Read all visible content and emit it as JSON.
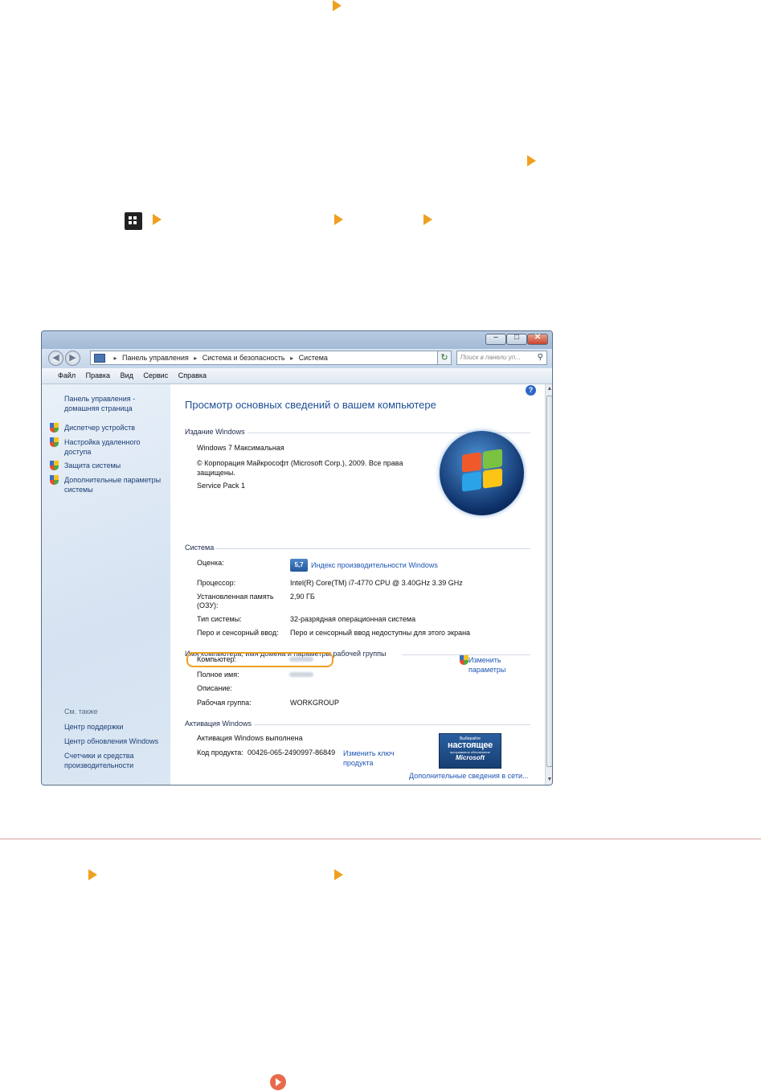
{
  "window": {
    "buttons": {
      "minimize": "–",
      "maximize": "□",
      "close": "✕"
    },
    "address": {
      "part1": "Панель управления",
      "part2": "Система и безопасность",
      "part3": "Система",
      "sep": "▸"
    },
    "search_placeholder": "Поиск в панели уп...",
    "menu": [
      "Файл",
      "Правка",
      "Вид",
      "Сервис",
      "Справка"
    ],
    "sidebar": {
      "home_link": "Панель управления - домашняя страница",
      "links": [
        "Диспетчер устройств",
        "Настройка удаленного доступа",
        "Защита системы",
        "Дополнительные параметры системы"
      ],
      "see_also_label": "См. также",
      "see_also": [
        "Центр поддержки",
        "Центр обновления Windows",
        "Счетчики и средства производительности"
      ]
    },
    "content": {
      "title": "Просмотр основных сведений о вашем компьютере",
      "edition": {
        "header": "Издание Windows",
        "name": "Windows 7 Максимальная",
        "copyright": "© Корпорация Майкрософт (Microsoft Corp.), 2009. Все права защищены.",
        "service_pack": "Service Pack 1"
      },
      "system": {
        "header": "Система",
        "rating_label": "Оценка:",
        "rating_score": "5,7",
        "rating_link": "Индекс производительности Windows",
        "processor_label": "Процессор:",
        "processor_value": "Intel(R) Core(TM) i7-4770 CPU @ 3.40GHz   3.39 GHz",
        "ram_label": "Установленная память (ОЗУ):",
        "ram_value": "2,90 ГБ",
        "type_label": "Тип системы:",
        "type_value": "32-разрядная операционная система",
        "pen_label": "Перо и сенсорный ввод:",
        "pen_value": "Перо и сенсорный ввод недоступны для этого экрана"
      },
      "computer": {
        "header": "Имя компьютера, имя домена и параметры рабочей группы",
        "name_label": "Компьютер:",
        "fullname_label": "Полное имя:",
        "desc_label": "Описание:",
        "workgroup_label": "Рабочая группа:",
        "workgroup_value": "WORKGROUP",
        "change_link": "Изменить параметры"
      },
      "activation": {
        "header": "Активация Windows",
        "status": "Активация Windows выполнена",
        "key_label": "Код продукта:",
        "key_value": "00426-065-2490997-86849",
        "change_key_link": "Изменить ключ продукта",
        "more_link": "Дополнительные сведения в сети...",
        "badge_top": "Выбирайте",
        "badge_main": "настоящее",
        "badge_sub": "программное обеспечение",
        "badge_brand": "Microsoft"
      }
    }
  }
}
